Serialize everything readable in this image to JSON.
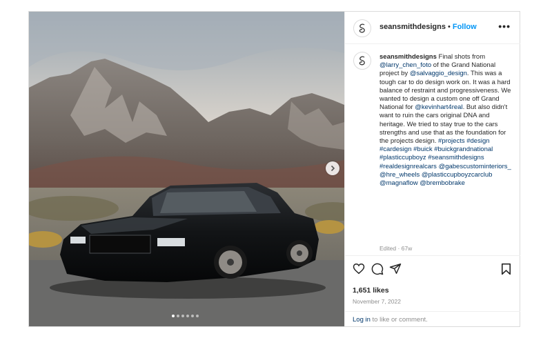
{
  "post": {
    "username": "seansmithdesigns",
    "separator": "•",
    "follow_label": "Follow",
    "more_label": "•••",
    "media_alt": "Black Buick Grand National parked in front of rocky mountains",
    "carousel_dots": 6,
    "carousel_active_index": 0
  },
  "caption": {
    "username": "seansmithdesigns",
    "t1": " Final shots from ",
    "m1": "@larry_chen_foto",
    "t2": " of the Grand National project by ",
    "m2": "@salvaggio_design",
    "t3": ". This was a tough car to do design work on. It was a hard balance of restraint and progressiveness. We wanted to design a custom one off Grand National for ",
    "m3": "@kevinhart4real",
    "t4": ". But also didn't want to ruin the cars original DNA and heritage. We tried to stay true to the cars strengths and use that as the foundation for the projects design. ",
    "h1": "#projects",
    "h2": "#design",
    "h3": "#cardesign",
    "h4": "#buick",
    "h5": "#buickgrandnational",
    "h6": "#plasticcupboyz",
    "h7": "#seansmithdesigns",
    "h8": "#realdesignrealcars",
    "m4": "@gabescustominteriors_",
    "m5": "@hre_wheels",
    "m6": "@plasticcupboyzcarclub",
    "m7": "@magnaflow",
    "m8": "@brembobrake",
    "edited": "Edited · 67w"
  },
  "footer": {
    "likes": "1,651 likes",
    "date": "November 7, 2022",
    "login_link": "Log in",
    "login_text": " to like or comment."
  }
}
